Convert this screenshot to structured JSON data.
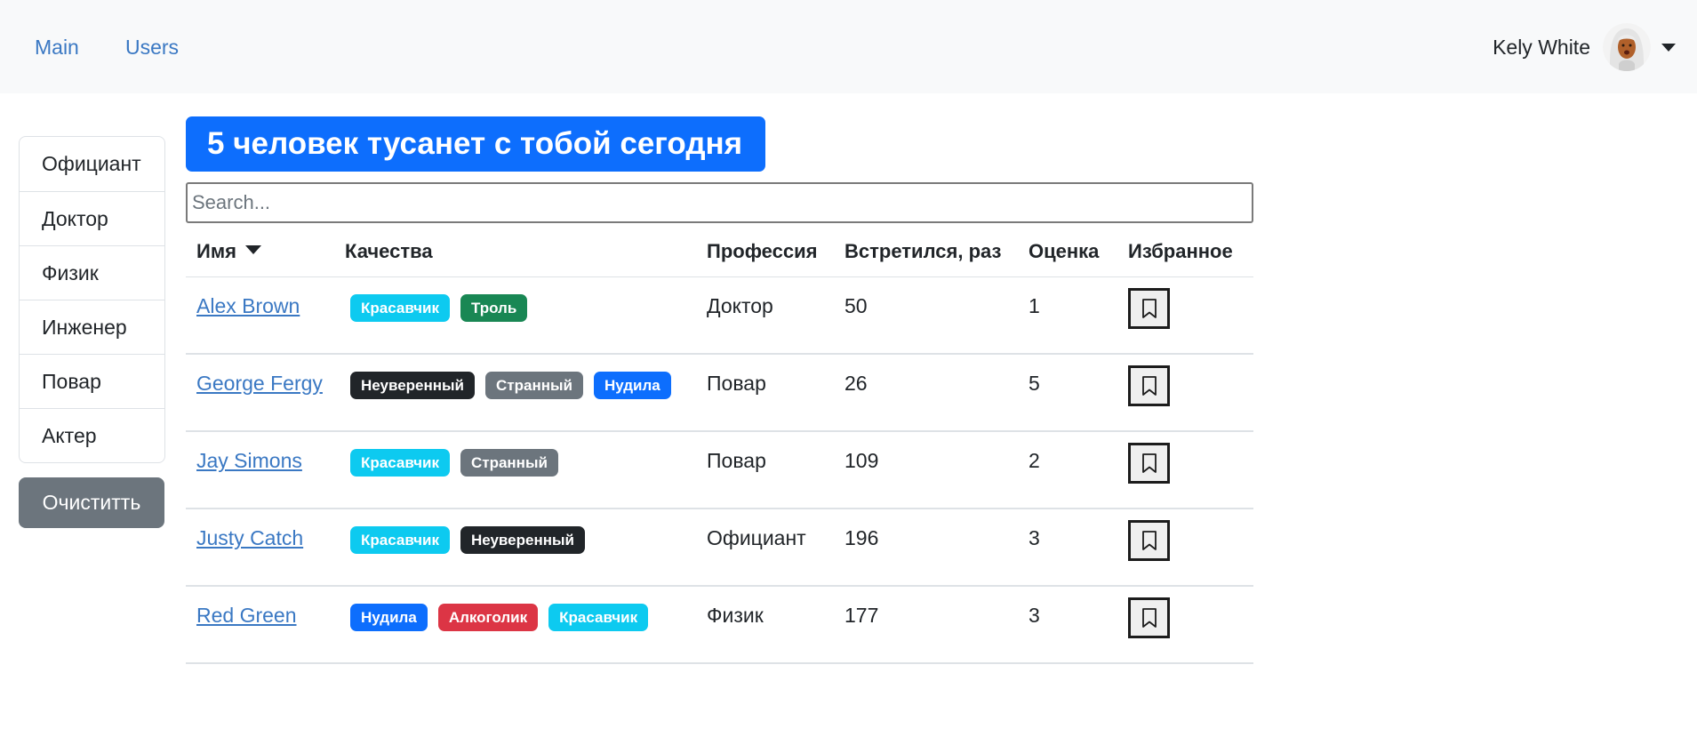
{
  "nav": {
    "links": [
      "Main",
      "Users"
    ],
    "user_name": "Kely White"
  },
  "sidebar": {
    "items": [
      "Официант",
      "Доктор",
      "Физик",
      "Инженер",
      "Повар",
      "Актер"
    ],
    "clear_label": "Очиститть"
  },
  "headline": "5 человек тусанет с тобой сегодня",
  "search": {
    "placeholder": "Search...",
    "value": ""
  },
  "table": {
    "headers": {
      "name": "Имя",
      "qualities": "Качества",
      "profession": "Профессия",
      "met": "Встретился, раз",
      "rating": "Оценка",
      "favorite": "Избранное"
    },
    "rows": [
      {
        "name": "Alex Brown",
        "qualities": [
          {
            "label": "Красавчик",
            "color": "#0dcaf0"
          },
          {
            "label": "Троль",
            "color": "#198754"
          }
        ],
        "profession": "Доктор",
        "met": "50",
        "rating": "1"
      },
      {
        "name": "George Fergy",
        "qualities": [
          {
            "label": "Неуверенный",
            "color": "#212529"
          },
          {
            "label": "Странный",
            "color": "#6c757d"
          },
          {
            "label": "Нудила",
            "color": "#0d6efd"
          }
        ],
        "profession": "Повар",
        "met": "26",
        "rating": "5"
      },
      {
        "name": "Jay Simons",
        "qualities": [
          {
            "label": "Красавчик",
            "color": "#0dcaf0"
          },
          {
            "label": "Странный",
            "color": "#6c757d"
          }
        ],
        "profession": "Повар",
        "met": "109",
        "rating": "2"
      },
      {
        "name": "Justy Catch",
        "qualities": [
          {
            "label": "Красавчик",
            "color": "#0dcaf0"
          },
          {
            "label": "Неуверенный",
            "color": "#212529"
          }
        ],
        "profession": "Официант",
        "met": "196",
        "rating": "3"
      },
      {
        "name": "Red Green",
        "qualities": [
          {
            "label": "Нудила",
            "color": "#0d6efd"
          },
          {
            "label": "Алкоголик",
            "color": "#dc3545"
          },
          {
            "label": "Красавчик",
            "color": "#0dcaf0"
          }
        ],
        "profession": "Физик",
        "met": "177",
        "rating": "3"
      }
    ]
  },
  "icons": {
    "sort": "caret-down-icon",
    "favorite": "bookmark-icon",
    "user_menu": "caret-down-icon"
  }
}
